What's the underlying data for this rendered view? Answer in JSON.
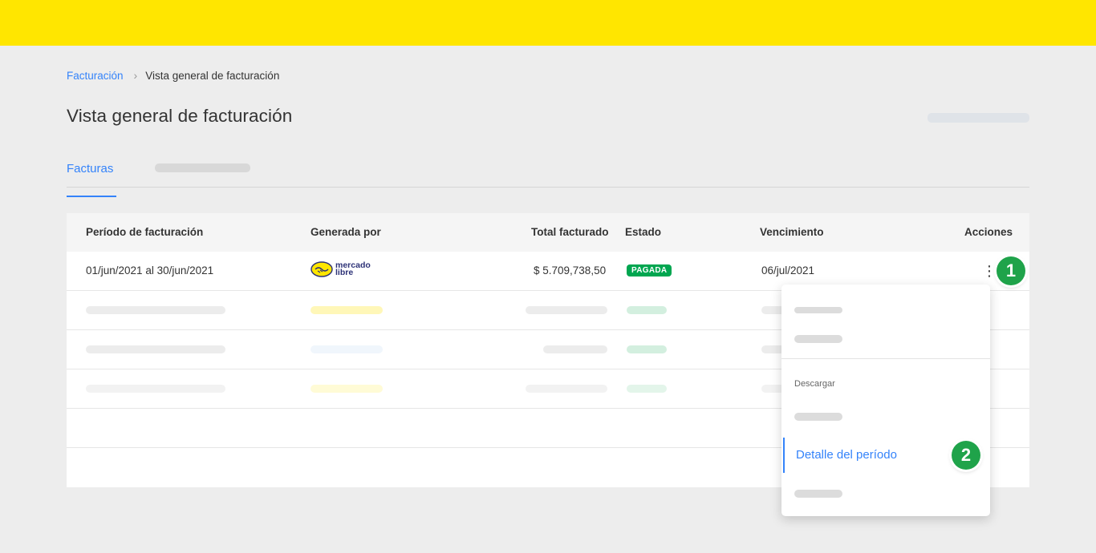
{
  "breadcrumb": {
    "parent": "Facturación",
    "separator": "›",
    "current": "Vista general de facturación"
  },
  "page": {
    "title": "Vista general de facturación"
  },
  "tabs": {
    "active": "Facturas"
  },
  "table": {
    "columns": [
      "Período de facturación",
      "Generada por",
      "Total facturado",
      "Estado",
      "Vencimiento",
      "Acciones"
    ],
    "row": {
      "period": "01/jun/2021 al 30/jun/2021",
      "generated_by_logo": "mercado libre",
      "total": "$ 5.709,738,50",
      "status": "PAGADA",
      "due": "06/jul/2021",
      "actions_icon": "kebab-menu-icon"
    }
  },
  "menu": {
    "section_label": "Descargar",
    "active_item": "Detalle del período"
  },
  "markers": [
    "1",
    "2"
  ],
  "colors": {
    "brand_yellow": "#ffe600",
    "accent_blue": "#3483fa",
    "status_green": "#00a650",
    "marker_green": "#1fa34a"
  }
}
